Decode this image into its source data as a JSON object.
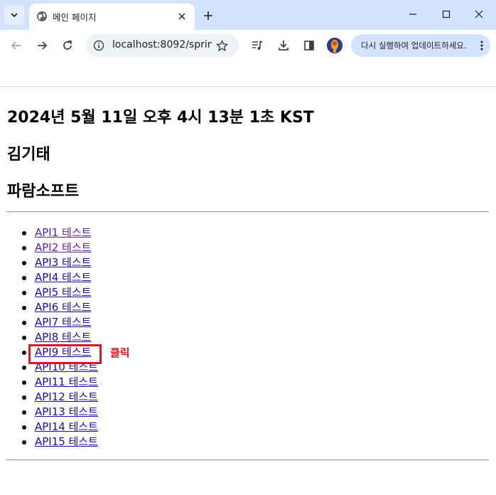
{
  "browser": {
    "tab_title": "메인 페이지",
    "url": "localhost:8092/sprin...",
    "update_button_label": "다시 실행하여 업데이트하세요.",
    "icons": {
      "tab_search": "chevron-down-icon",
      "favicon": "globe-icon",
      "tab_close": "close-icon",
      "new_tab": "plus-icon",
      "minimize": "minimize-icon",
      "maximize": "maximize-icon",
      "close_window": "close-icon",
      "back": "arrow-left-icon",
      "forward": "arrow-right-icon",
      "reload": "reload-icon",
      "site_info": "info-icon",
      "bookmark": "star-icon",
      "media": "media-queue-icon",
      "download": "download-icon",
      "side_panel": "side-panel-icon",
      "menu": "more-vertical-icon"
    }
  },
  "page": {
    "datetime": "2024년 5월 11일 오후 4시 13분 1초 KST",
    "name": "김기태",
    "company": "파람소프트",
    "links": [
      {
        "label": "API1 테스트",
        "visited": true
      },
      {
        "label": "API2 테스트",
        "visited": true
      },
      {
        "label": "API3 테스트",
        "visited": false
      },
      {
        "label": "API4 테스트",
        "visited": false
      },
      {
        "label": "API5 테스트",
        "visited": false
      },
      {
        "label": "API6 테스트",
        "visited": false
      },
      {
        "label": "API7 테스트",
        "visited": false
      },
      {
        "label": "API8 테스트",
        "visited": false
      },
      {
        "label": "API9 테스트",
        "visited": false
      },
      {
        "label": "API10 테스트",
        "visited": false
      },
      {
        "label": "API11 테스트",
        "visited": false
      },
      {
        "label": "API12 테스트",
        "visited": false
      },
      {
        "label": "API13 테스트",
        "visited": false
      },
      {
        "label": "API14 테스트",
        "visited": false
      },
      {
        "label": "API15 테스트",
        "visited": false
      }
    ]
  },
  "annotation": {
    "highlighted_link": "API9 테스트",
    "note": "클릭",
    "color": "#e0151d"
  },
  "colors": {
    "titlebar": "#d3e3fd",
    "link": "#1a0dab",
    "visited_link": "#681da8"
  }
}
